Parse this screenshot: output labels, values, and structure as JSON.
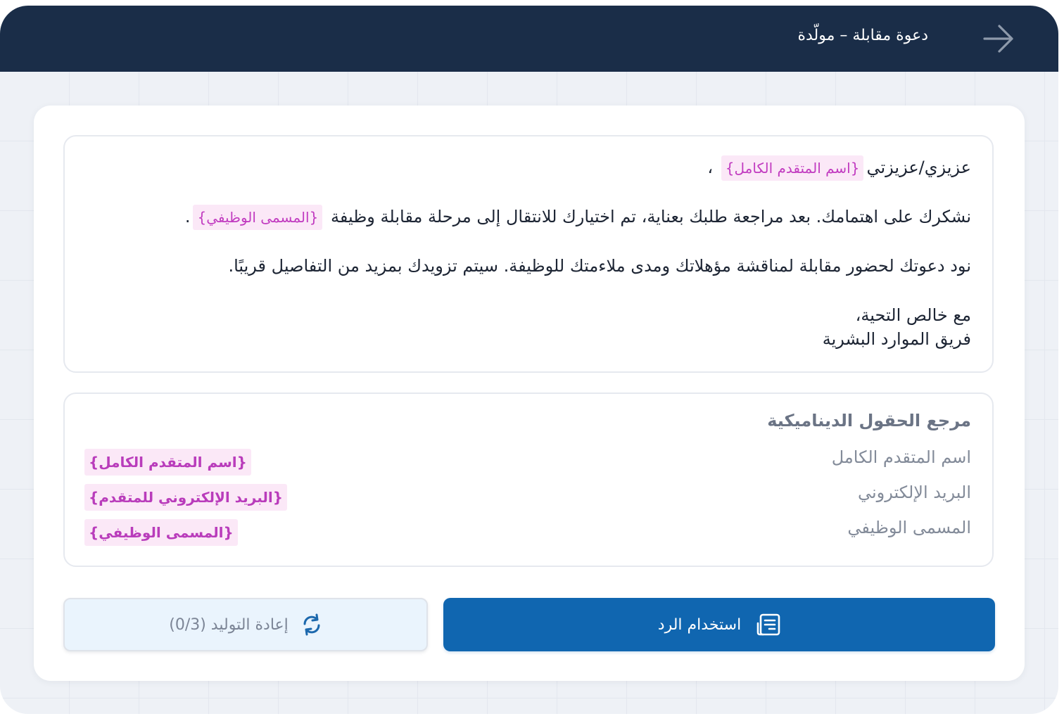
{
  "header": {
    "title": "دعوة مقابلة – مولّدة",
    "back_icon": "arrow-right-icon"
  },
  "message": {
    "greeting": "عزيزي/عزيزتي",
    "greeting_field": "{اسم المتقدم الكامل}",
    "greeting_suffix": "،",
    "line2_text": "نشكرك على اهتمامك. بعد مراجعة طلبك بعناية، تم اختيارك للانتقال إلى مرحلة مقابلة وظيفة",
    "line2_field": "{المسمى الوظيفي}",
    "line2_suffix": ".",
    "line3_text": "نود دعوتك لحضور مقابلة لمناقشة مؤهلاتك ومدى ملاءمتك للوظيفة. سيتم تزويدك بمزيد من التفاصيل قريبًا.",
    "closing": "مع خالص التحية،",
    "signature": "فريق الموارد البشرية"
  },
  "reference": {
    "title": "مرجع الحقول الديناميكية",
    "items": [
      {
        "label": "اسم المتقدم الكامل",
        "token": "{اسم المتقدم الكامل}"
      },
      {
        "label": "البريد الإلكتروني",
        "token": "{البريد الإلكتروني للمتقدم}"
      },
      {
        "label": "المسمى الوظيفي",
        "token": "{المسمى الوظيفي}"
      }
    ]
  },
  "actions": {
    "use_label": "استخدام الرد",
    "use_icon": "document-text-icon",
    "regen_label": "إعادة التوليد (0/3)",
    "regen_icon": "refresh-icon"
  },
  "colors": {
    "header_bg": "#1a2d48",
    "primary": "#1066b0",
    "chip_bg": "#fbe8f7",
    "chip_text": "#c13bc0",
    "regen_bg": "#eaf4fd"
  }
}
